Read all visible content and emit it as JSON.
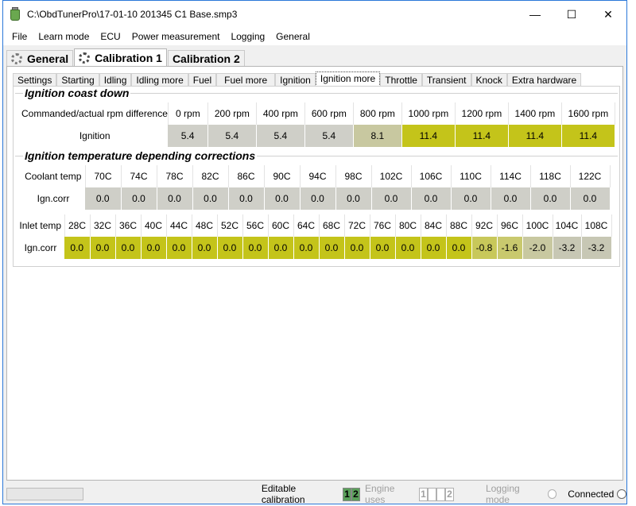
{
  "window": {
    "title": "C:\\ObdTunerPro\\17-01-10 201345 C1 Base.smp3"
  },
  "menu": [
    "File",
    "Learn mode",
    "ECU",
    "Power measurement",
    "Logging",
    "General"
  ],
  "main_tabs": [
    {
      "label": "General"
    },
    {
      "label": "Calibration 1"
    },
    {
      "label": "Calibration 2"
    }
  ],
  "sub_tabs": [
    "Settings",
    "Starting",
    "Idling",
    "Idling more",
    "Fuel",
    "Fuel more",
    "Ignition",
    "Ignition more",
    "Throttle",
    "Transient",
    "Knock",
    "Extra hardware"
  ],
  "coast": {
    "title": "Ignition coast down",
    "header_label": "Commanded/actual rpm difference",
    "row_label": "Ignition",
    "columns": [
      "0 rpm",
      "200 rpm",
      "400 rpm",
      "600 rpm",
      "800 rpm",
      "1000 rpm",
      "1200 rpm",
      "1400 rpm",
      "1600 rpm"
    ],
    "values": [
      "5.4",
      "5.4",
      "5.4",
      "5.4",
      "8.1",
      "11.4",
      "11.4",
      "11.4",
      "11.4"
    ]
  },
  "temp": {
    "title": "Ignition temperature depending corrections",
    "coolant": {
      "header_label": "Coolant temp",
      "row_label": "Ign.corr",
      "columns": [
        "70C",
        "74C",
        "78C",
        "82C",
        "86C",
        "90C",
        "94C",
        "98C",
        "102C",
        "106C",
        "110C",
        "114C",
        "118C",
        "122C"
      ],
      "values": [
        "0.0",
        "0.0",
        "0.0",
        "0.0",
        "0.0",
        "0.0",
        "0.0",
        "0.0",
        "0.0",
        "0.0",
        "0.0",
        "0.0",
        "0.0",
        "0.0"
      ]
    },
    "inlet": {
      "header_label": "Inlet temp",
      "row_label": "Ign.corr",
      "columns": [
        "28C",
        "32C",
        "36C",
        "40C",
        "44C",
        "48C",
        "52C",
        "56C",
        "60C",
        "64C",
        "68C",
        "72C",
        "76C",
        "80C",
        "84C",
        "88C",
        "92C",
        "96C",
        "100C",
        "104C",
        "108C"
      ],
      "values": [
        "0.0",
        "0.0",
        "0.0",
        "0.0",
        "0.0",
        "0.0",
        "0.0",
        "0.0",
        "0.0",
        "0.0",
        "0.0",
        "0.0",
        "0.0",
        "0.0",
        "0.0",
        "0.0",
        "-0.8",
        "-1.6",
        "-2.0",
        "-3.2",
        "-3.2"
      ]
    }
  },
  "status": {
    "editable_label": "Editable calibration",
    "editable_values": [
      "1",
      "2"
    ],
    "engine_uses_label": "Engine uses",
    "engine_uses_values": [
      "1",
      "",
      "",
      "2"
    ],
    "logging_mode_label": "Logging mode",
    "connected_label": "Connected"
  },
  "colors": {
    "accent_border": "#2b78d9",
    "cell_gray": "#cfcfc8",
    "cell_yellow": "#c4c41a",
    "editable_green": "#5aa05a"
  }
}
